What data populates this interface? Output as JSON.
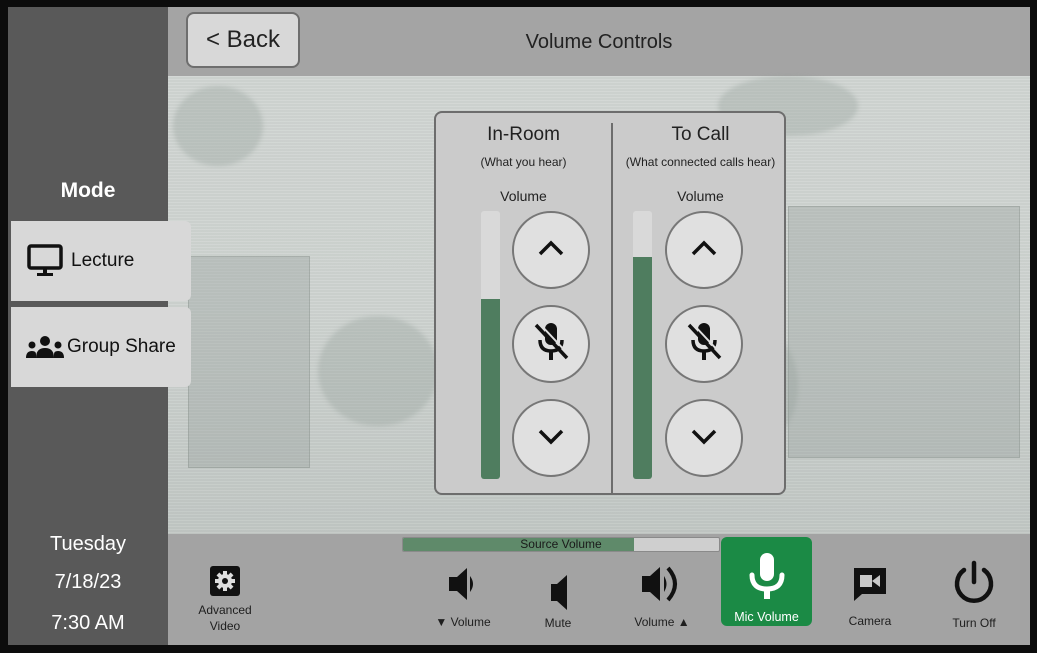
{
  "header": {
    "back_label": "< Back",
    "title": "Volume Controls"
  },
  "sidebar": {
    "mode_title": "Mode",
    "modes": [
      {
        "label": "Lecture",
        "icon": "monitor-icon"
      },
      {
        "label": "Group Share",
        "icon": "group-icon"
      }
    ],
    "day": "Tuesday",
    "date": "7/18/23",
    "time": "7:30 AM"
  },
  "volume_panel": {
    "in_room": {
      "title": "In-Room",
      "subtitle": "(What you hear)",
      "volume_label": "Volume",
      "level": 0.67,
      "buttons": [
        "chevron-up-icon",
        "mic-mute-icon",
        "chevron-down-icon"
      ]
    },
    "to_call": {
      "title": "To Call",
      "subtitle": "(What connected calls hear)",
      "volume_label": "Volume",
      "level": 0.83,
      "buttons": [
        "chevron-up-icon",
        "mic-mute-icon",
        "chevron-down-icon"
      ]
    }
  },
  "bottom_bar": {
    "source_volume": {
      "label": "Source Volume",
      "level": 0.73
    },
    "advanced_video": {
      "label_line1": "Advanced",
      "label_line2": "Video",
      "icon": "gear-icon"
    },
    "volume_down": {
      "label": "▼ Volume",
      "icon": "speaker-low-icon"
    },
    "mute": {
      "label": "Mute",
      "icon": "speaker-mute-icon"
    },
    "volume_up": {
      "label": "Volume ▲",
      "icon": "speaker-high-icon"
    },
    "mic_volume": {
      "label": "Mic Volume",
      "icon": "microphone-icon",
      "active": true
    },
    "camera": {
      "label": "Camera",
      "icon": "camera-icon"
    },
    "turn_off": {
      "label": "Turn Off",
      "icon": "power-icon"
    }
  },
  "colors": {
    "accent_green": "#1b8a45",
    "meter_green": "#4f7d5f"
  }
}
